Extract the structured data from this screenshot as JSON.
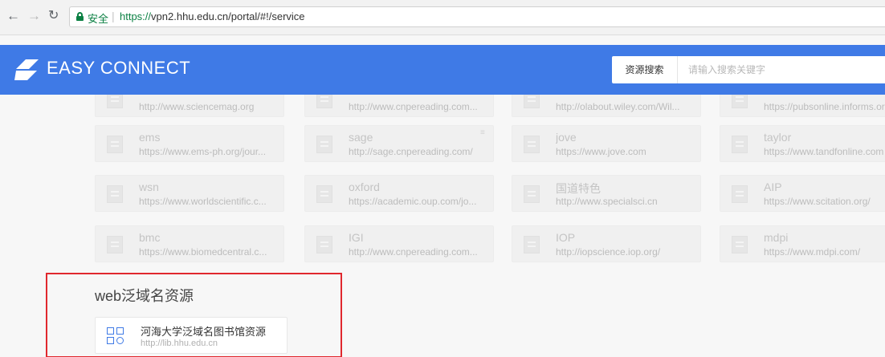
{
  "browser": {
    "secure_label": "安全",
    "url_scheme": "https://",
    "url_rest": "vpn2.hhu.edu.cn/portal/#!/service"
  },
  "header": {
    "logo_text": "EASY CONNECT",
    "search_label": "资源搜索",
    "search_placeholder": "请输入搜索关键字",
    "accent_color": "#3f7ae6"
  },
  "resources": {
    "rows": [
      [
        {
          "title": "",
          "url": "http://www.sciencemag.org"
        },
        {
          "title": "",
          "url": "http://www.cnpereading.com..."
        },
        {
          "title": "",
          "url": "http://olabout.wiley.com/Wil..."
        },
        {
          "title": "",
          "url": "https://pubsonline.informs.or"
        }
      ],
      [
        {
          "title": "ems",
          "url": "https://www.ems-ph.org/jour..."
        },
        {
          "title": "sage",
          "url": "http://sage.cnpereading.com/"
        },
        {
          "title": "jove",
          "url": "https://www.jove.com"
        },
        {
          "title": "taylor",
          "url": "https://www.tandfonline.com"
        }
      ],
      [
        {
          "title": "wsn",
          "url": "https://www.worldscientific.c..."
        },
        {
          "title": "oxford",
          "url": "https://academic.oup.com/jo..."
        },
        {
          "title": "国道特色",
          "url": "http://www.specialsci.cn"
        },
        {
          "title": "AIP",
          "url": "https://www.scitation.org/"
        }
      ],
      [
        {
          "title": "bmc",
          "url": "https://www.biomedcentral.c..."
        },
        {
          "title": "IGI",
          "url": "http://www.cnpereading.com..."
        },
        {
          "title": "IOP",
          "url": "http://iopscience.iop.org/"
        },
        {
          "title": "mdpi",
          "url": "https://www.mdpi.com/"
        }
      ]
    ]
  },
  "web_section": {
    "title": "web泛域名资源",
    "item": {
      "title": "河海大学泛域名图书馆资源",
      "url": "http://lib.hhu.edu.cn"
    },
    "highlight_color": "#e0282e"
  }
}
